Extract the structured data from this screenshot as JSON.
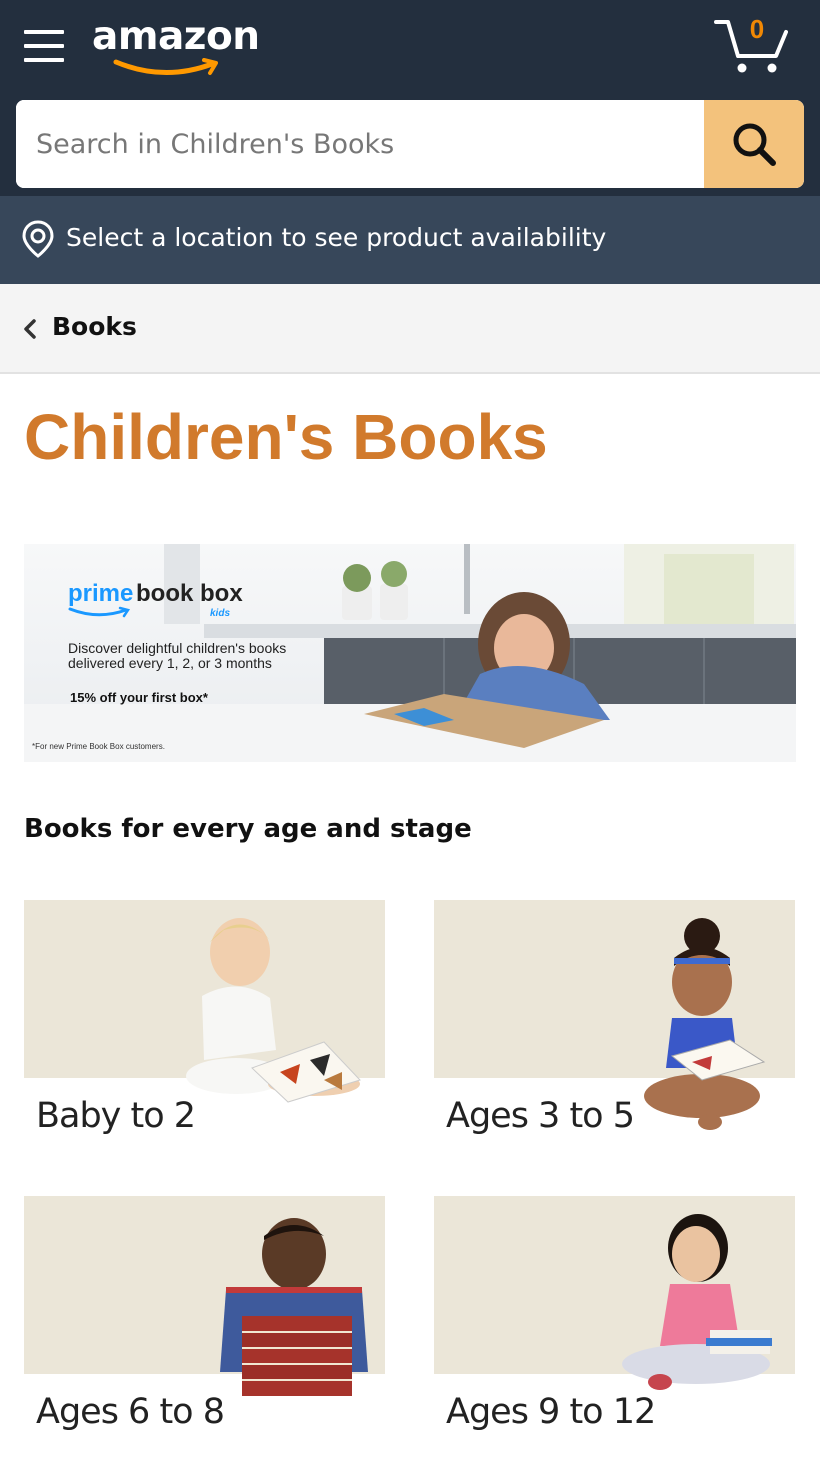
{
  "header": {
    "logo_text": "amazon",
    "cart_count": "0",
    "search_placeholder": "Search in Children's Books",
    "location_text": "Select a location to see product availability"
  },
  "breadcrumb": {
    "label": "Books"
  },
  "page_title": "Children's Books",
  "banner": {
    "brand_prime": "prime",
    "brand_bookbox": "book box",
    "brand_kids": "kids",
    "line1": "Discover delightful children's books",
    "line2": "delivered every 1, 2, or 3 months",
    "offer": "15% off your first box*",
    "footnote": "*For new Prime Book Box customers."
  },
  "section_title": "Books for every age and stage",
  "age_tiles": [
    {
      "label": "Baby to 2"
    },
    {
      "label": "Ages 3 to 5"
    },
    {
      "label": "Ages 6 to 8"
    },
    {
      "label": "Ages 9 to 12"
    }
  ],
  "colors": {
    "header_bg": "#232f3e",
    "location_bg": "#37475a",
    "search_button": "#f3c27c",
    "title_orange": "#d17a2c",
    "cart_count": "#f08804",
    "tile_bg": "#ebe6d8"
  },
  "icons": {
    "menu": "hamburger-menu-icon",
    "cart": "cart-icon",
    "search": "search-icon",
    "location": "location-pin-icon",
    "back": "chevron-left-icon"
  }
}
